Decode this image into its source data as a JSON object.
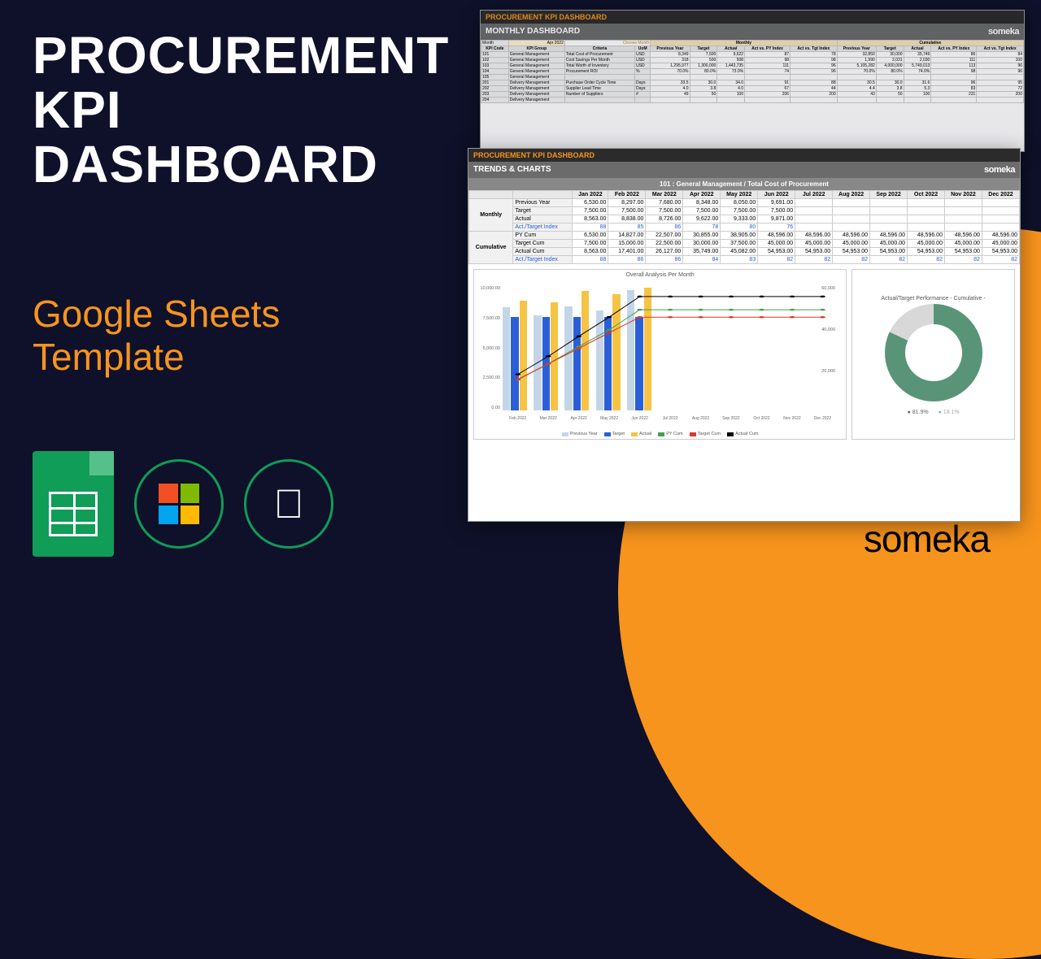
{
  "title_l1": "PROCUREMENT",
  "title_l2": "KPI",
  "title_l3": "DASHBOARD",
  "subtitle_l1": "Google Sheets",
  "subtitle_l2": "Template",
  "brand": "someka",
  "panel_back": {
    "bar": "PROCUREMENT KPI DASHBOARD",
    "section": "MONTHLY DASHBOARD",
    "month_label": "Month",
    "month_value": "Apr 2022",
    "choose": "Choose Month",
    "group_monthly": "Monthly",
    "group_cumulative": "Cumulative",
    "cols": [
      "KPI Code",
      "KPI Group",
      "Criteria",
      "UoM",
      "Previous Year",
      "Target",
      "Actual",
      "Act vs. PY Index",
      "Act vs. Tgt Index",
      "Previous Year",
      "Target",
      "Actual",
      "Act vs. PY Index",
      "Act vs. Tgt Index"
    ],
    "rows": [
      [
        "101",
        "General Management",
        "Total Cost of Procurement",
        "USD",
        "8,349",
        "7,500",
        "9,622",
        "87",
        "78",
        "32,850",
        "30,000",
        "35,749",
        "86",
        "84"
      ],
      [
        "102",
        "General Management",
        "Cost Savings Per Month",
        "USD",
        "318",
        "500",
        "508",
        "98",
        "98",
        "1,990",
        "2,031",
        "2,030",
        "111",
        "100"
      ],
      [
        "103",
        "General Management",
        "Total Worth of Inventory",
        "USD",
        "1,295,977",
        "1,300,000",
        "1,443,735",
        "111",
        "96",
        "5,105,282",
        "4,000,000",
        "5,749,013",
        "113",
        "96"
      ],
      [
        "104",
        "General Management",
        "Procurement ROI",
        "%",
        "70.0%",
        "80.0%",
        "73.0%",
        "74",
        "96",
        "70.0%",
        "80.0%",
        "74.0%",
        "98",
        "96"
      ],
      [
        "105",
        "General Management",
        "",
        "",
        "",
        "",
        "",
        "",
        "",
        "",
        "",
        "",
        "",
        ""
      ],
      [
        "201",
        "Delivery Management",
        "Purchase Order Cycle Time",
        "Days",
        "33.5",
        "30.0",
        "34.0",
        "91",
        "88",
        "30.5",
        "30.0",
        "31.6",
        "96",
        "95"
      ],
      [
        "202",
        "Delivery Management",
        "Supplier Lead Time",
        "Days",
        "4.0",
        "3.8",
        "4.0",
        "67",
        "44",
        "4.4",
        "3.8",
        "5.3",
        "83",
        "72"
      ],
      [
        "203",
        "Delivery Management",
        "Number of Suppliers",
        "#",
        "49",
        "50",
        "100",
        "206",
        "200",
        "43",
        "50",
        "100",
        "231",
        "200"
      ],
      [
        "204",
        "Delivery Management",
        "",
        "",
        "",
        "",
        "",
        "",
        "",
        "",
        "",
        "",
        "",
        ""
      ]
    ]
  },
  "panel_front": {
    "bar": "PROCUREMENT KPI DASHBOARD",
    "section": "TRENDS & CHARTS",
    "kpi_title": "101 : General Management / Total Cost of Procurement",
    "months": [
      "Jan 2022",
      "Feb 2022",
      "Mar 2022",
      "Apr 2022",
      "May 2022",
      "Jun 2022",
      "Jul 2022",
      "Aug 2022",
      "Sep 2022",
      "Oct 2022",
      "Nov 2022",
      "Dec 2022"
    ],
    "monthly": {
      "label": "Monthly",
      "rows": [
        {
          "name": "Previous Year",
          "vals": [
            "6,530.00",
            "8,297.00",
            "7,680.00",
            "8,348.00",
            "8,050.00",
            "9,691.00",
            "",
            "",
            "",
            "",
            "",
            ""
          ]
        },
        {
          "name": "Target",
          "vals": [
            "7,500.00",
            "7,500.00",
            "7,500.00",
            "7,500.00",
            "7,500.00",
            "7,500.00",
            "",
            "",
            "",
            "",
            "",
            ""
          ]
        },
        {
          "name": "Actual",
          "vals": [
            "8,563.00",
            "8,838.00",
            "8,726.00",
            "9,622.00",
            "9,333.00",
            "9,871.00",
            "",
            "",
            "",
            "",
            "",
            ""
          ]
        },
        {
          "name": "Act./Target Index",
          "vals": [
            "88",
            "85",
            "86",
            "78",
            "80",
            "76",
            "",
            "",
            "",
            "",
            "",
            ""
          ],
          "blue": true
        }
      ]
    },
    "cumulative": {
      "label": "Cumulative",
      "rows": [
        {
          "name": "PY Cum",
          "vals": [
            "6,530.00",
            "14,827.00",
            "22,507.00",
            "30,855.00",
            "38,905.00",
            "48,596.00",
            "48,596.00",
            "48,596.00",
            "48,596.00",
            "48,596.00",
            "48,596.00",
            "48,596.00"
          ]
        },
        {
          "name": "Target Cum",
          "vals": [
            "7,500.00",
            "15,000.00",
            "22,500.00",
            "30,000.00",
            "37,500.00",
            "45,000.00",
            "45,000.00",
            "45,000.00",
            "45,000.00",
            "45,000.00",
            "45,000.00",
            "45,000.00"
          ]
        },
        {
          "name": "Actual Cum",
          "vals": [
            "8,563.00",
            "17,401.00",
            "26,127.00",
            "35,749.00",
            "45,082.00",
            "54,953.00",
            "54,953.00",
            "54,953.00",
            "54,953.00",
            "54,953.00",
            "54,953.00",
            "54,953.00"
          ]
        },
        {
          "name": "Act./Target Index",
          "vals": [
            "88",
            "86",
            "86",
            "84",
            "83",
            "82",
            "82",
            "82",
            "82",
            "82",
            "82",
            "82"
          ],
          "blue": true
        }
      ]
    }
  },
  "chart_data": [
    {
      "type": "bar",
      "title": "Overall Analysis Per Month",
      "categories": [
        "Feb 2022",
        "Mar 2022",
        "Apr 2022",
        "May 2022",
        "Jun 2022",
        "Jul 2022",
        "Aug 2022",
        "Sep 2022",
        "Oct 2022",
        "Nov 2022",
        "Dec 2022"
      ],
      "series": [
        {
          "name": "Previous Year",
          "values": [
            8297,
            7680,
            8348,
            8050,
            9691,
            null,
            null,
            null,
            null,
            null,
            null
          ],
          "axis": "left",
          "kind": "bar"
        },
        {
          "name": "Target",
          "values": [
            7500,
            7500,
            7500,
            7500,
            7500,
            null,
            null,
            null,
            null,
            null,
            null
          ],
          "axis": "left",
          "kind": "bar"
        },
        {
          "name": "Actual",
          "values": [
            8838,
            8726,
            9622,
            9333,
            9871,
            null,
            null,
            null,
            null,
            null,
            null
          ],
          "axis": "left",
          "kind": "bar"
        },
        {
          "name": "PY Cum",
          "values": [
            14827,
            22507,
            30855,
            38905,
            48596,
            48596,
            48596,
            48596,
            48596,
            48596,
            48596
          ],
          "axis": "right",
          "kind": "line"
        },
        {
          "name": "Target Cum",
          "values": [
            15000,
            22500,
            30000,
            37500,
            45000,
            45000,
            45000,
            45000,
            45000,
            45000,
            45000
          ],
          "axis": "right",
          "kind": "line"
        },
        {
          "name": "Actual Cum",
          "values": [
            17401,
            26127,
            35749,
            45082,
            54953,
            54953,
            54953,
            54953,
            54953,
            54953,
            54953
          ],
          "axis": "right",
          "kind": "line"
        }
      ],
      "ylim_left": [
        0,
        10000
      ],
      "yticks_left": [
        "0.00",
        "2,500.00",
        "5,000.00",
        "7,500.00",
        "10,000.00"
      ],
      "ylim_right": [
        0,
        60000
      ],
      "yticks_right": [
        "",
        "20,000",
        "40,000",
        "60,000"
      ],
      "legend": [
        "Previous Year",
        "Target",
        "Actual",
        "PY Cum",
        "Target Cum",
        "Actual Cum"
      ]
    },
    {
      "type": "pie",
      "title": "Actual/Target Performance - Cumulative -",
      "slices": [
        {
          "name": "81.9%",
          "value": 81.9
        },
        {
          "name": "18.1%",
          "value": 18.1
        }
      ]
    }
  ]
}
